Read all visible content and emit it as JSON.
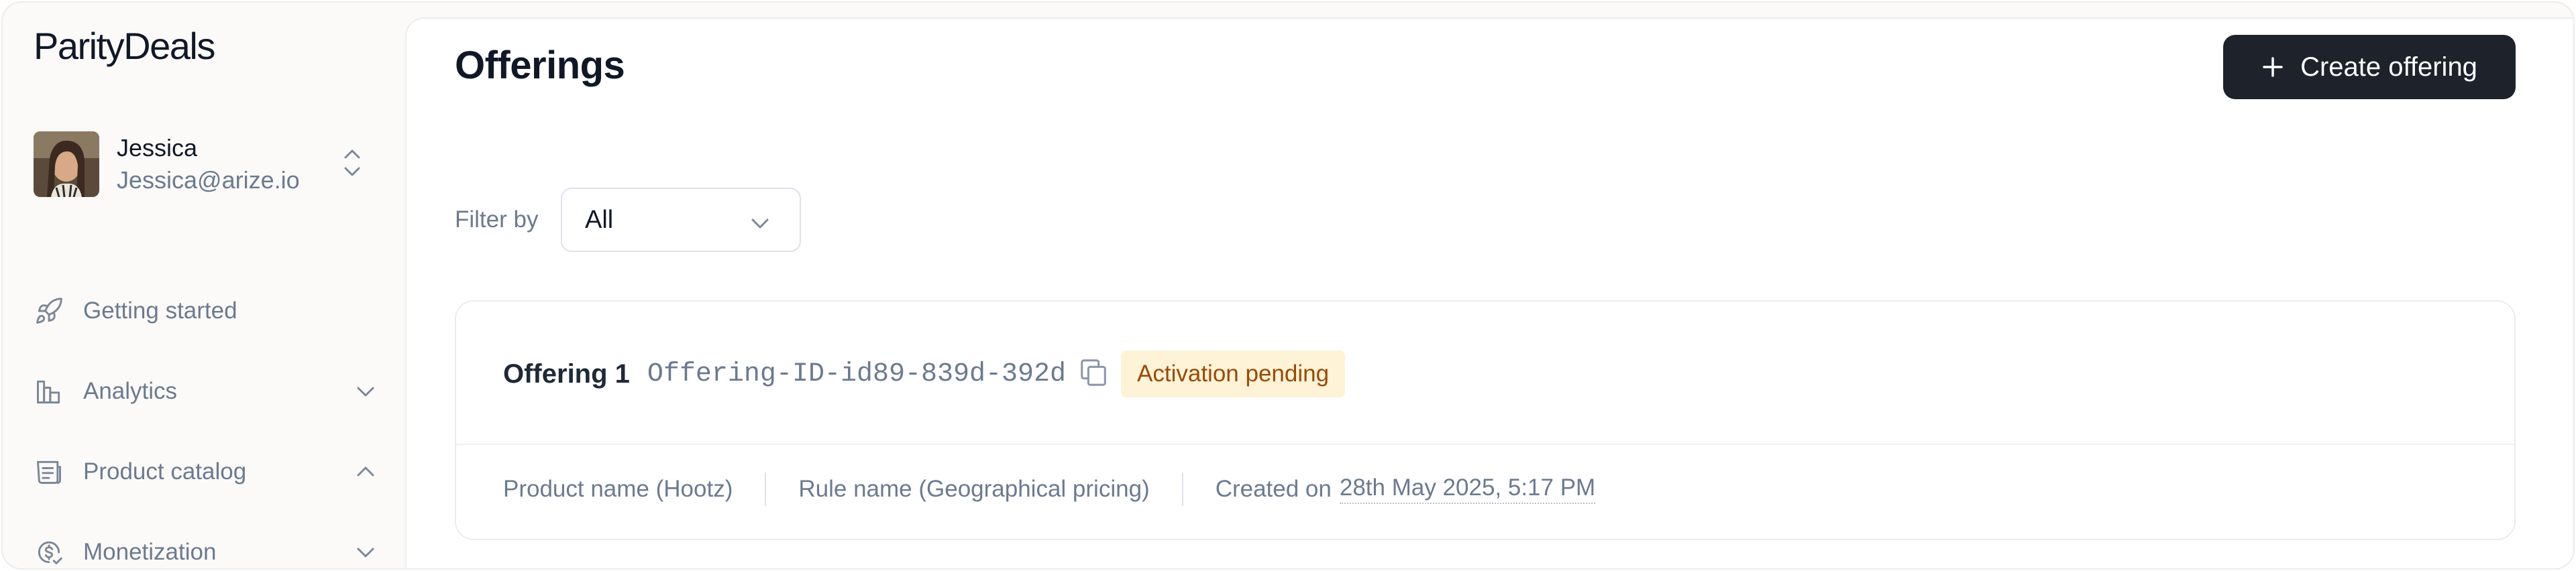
{
  "app": {
    "logo": "ParityDeals"
  },
  "user": {
    "name": "Jessica",
    "email": "Jessica@arize.io"
  },
  "nav": {
    "items": [
      {
        "label": "Getting started",
        "icon": "rocket-icon"
      },
      {
        "label": "Analytics",
        "icon": "bar-chart-icon",
        "state": "collapsed"
      },
      {
        "label": "Product catalog",
        "icon": "catalog-icon",
        "state": "expanded"
      },
      {
        "label": "Monetization",
        "icon": "money-icon",
        "state": "collapsed"
      }
    ]
  },
  "page": {
    "title": "Offerings",
    "create_button": "Create offering"
  },
  "filter": {
    "label": "Filter by",
    "value": "All"
  },
  "offering": {
    "name": "Offering 1",
    "id": "Offering-ID-id89-839d-392d",
    "status": "Activation pending",
    "product": "Product name (Hootz)",
    "rule": "Rule name (Geographical pricing)",
    "created_prefix": "Created on",
    "created_date": "28th May 2025, 5:17 PM"
  },
  "colors": {
    "primary_button": "#1d222b",
    "badge_bg": "#fef3d7",
    "badge_text": "#9a4a06",
    "muted_text": "#6b7a90"
  }
}
